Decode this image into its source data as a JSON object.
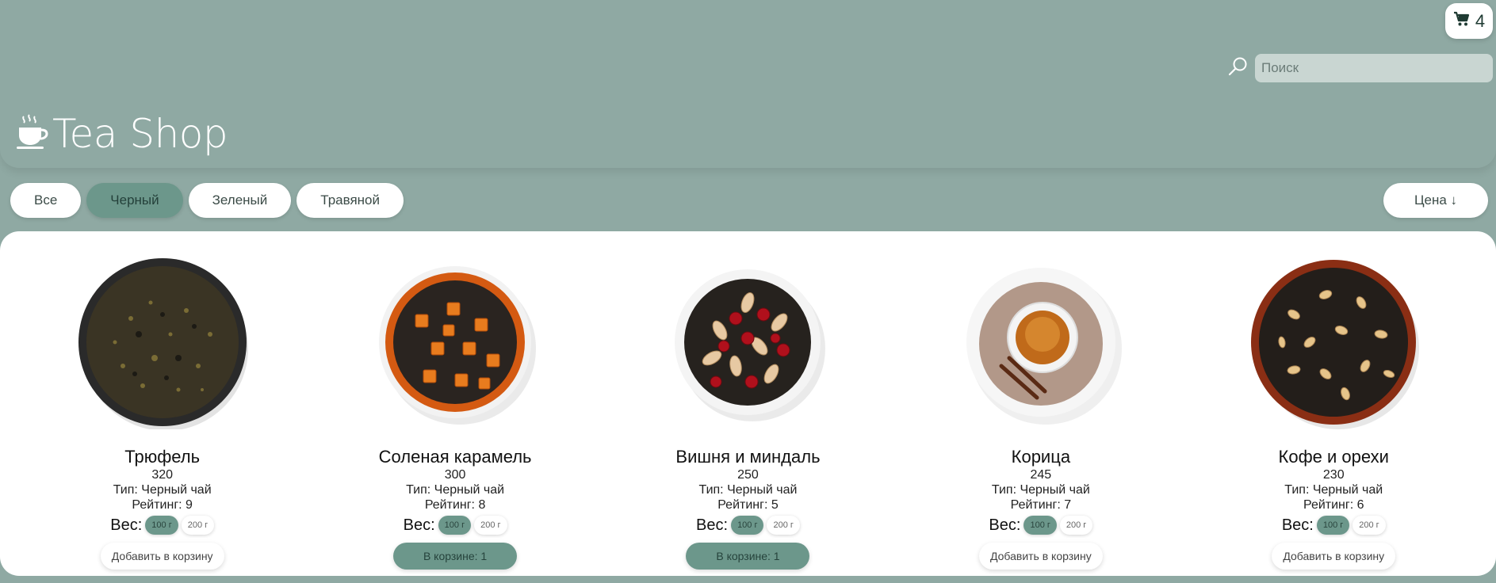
{
  "header": {
    "cart_count": "4",
    "search_placeholder": "Поиск",
    "logo_text": "Tea Shop"
  },
  "filters": [
    {
      "label": "Все",
      "active": false
    },
    {
      "label": "Черный",
      "active": true
    },
    {
      "label": "Зеленый",
      "active": false
    },
    {
      "label": "Травяной",
      "active": false
    }
  ],
  "sort_label": "Цена ↓",
  "products": [
    {
      "name": "Трюфель",
      "price": "320",
      "type": "Тип: Черный чай",
      "rating": "Рейтинг: 9",
      "weight_label": "Вес:",
      "weights": [
        "100 г",
        "200 г"
      ],
      "button": "Добавить в корзину",
      "in_cart": false
    },
    {
      "name": "Соленая карамель",
      "price": "300",
      "type": "Тип: Черный чай",
      "rating": "Рейтинг: 8",
      "weight_label": "Вес:",
      "weights": [
        "100 г",
        "200 г"
      ],
      "button": "В корзине: 1",
      "in_cart": true
    },
    {
      "name": "Вишня и миндаль",
      "price": "250",
      "type": "Тип: Черный чай",
      "rating": "Рейтинг: 5",
      "weight_label": "Вес:",
      "weights": [
        "100 г",
        "200 г"
      ],
      "button": "В корзине: 1",
      "in_cart": true
    },
    {
      "name": "Корица",
      "price": "245",
      "type": "Тип: Черный чай",
      "rating": "Рейтинг: 7",
      "weight_label": "Вес:",
      "weights": [
        "100 г",
        "200 г"
      ],
      "button": "Добавить в корзину",
      "in_cart": false
    },
    {
      "name": "Кофе и орехи",
      "price": "230",
      "type": "Тип: Черный чай",
      "rating": "Рейтинг: 6",
      "weight_label": "Вес:",
      "weights": [
        "100 г",
        "200 г"
      ],
      "button": "Добавить в корзину",
      "in_cart": false
    }
  ],
  "colors": {
    "background": "#8fa9a3",
    "accent": "#6c978b",
    "search_bg": "#c9d6d2"
  }
}
